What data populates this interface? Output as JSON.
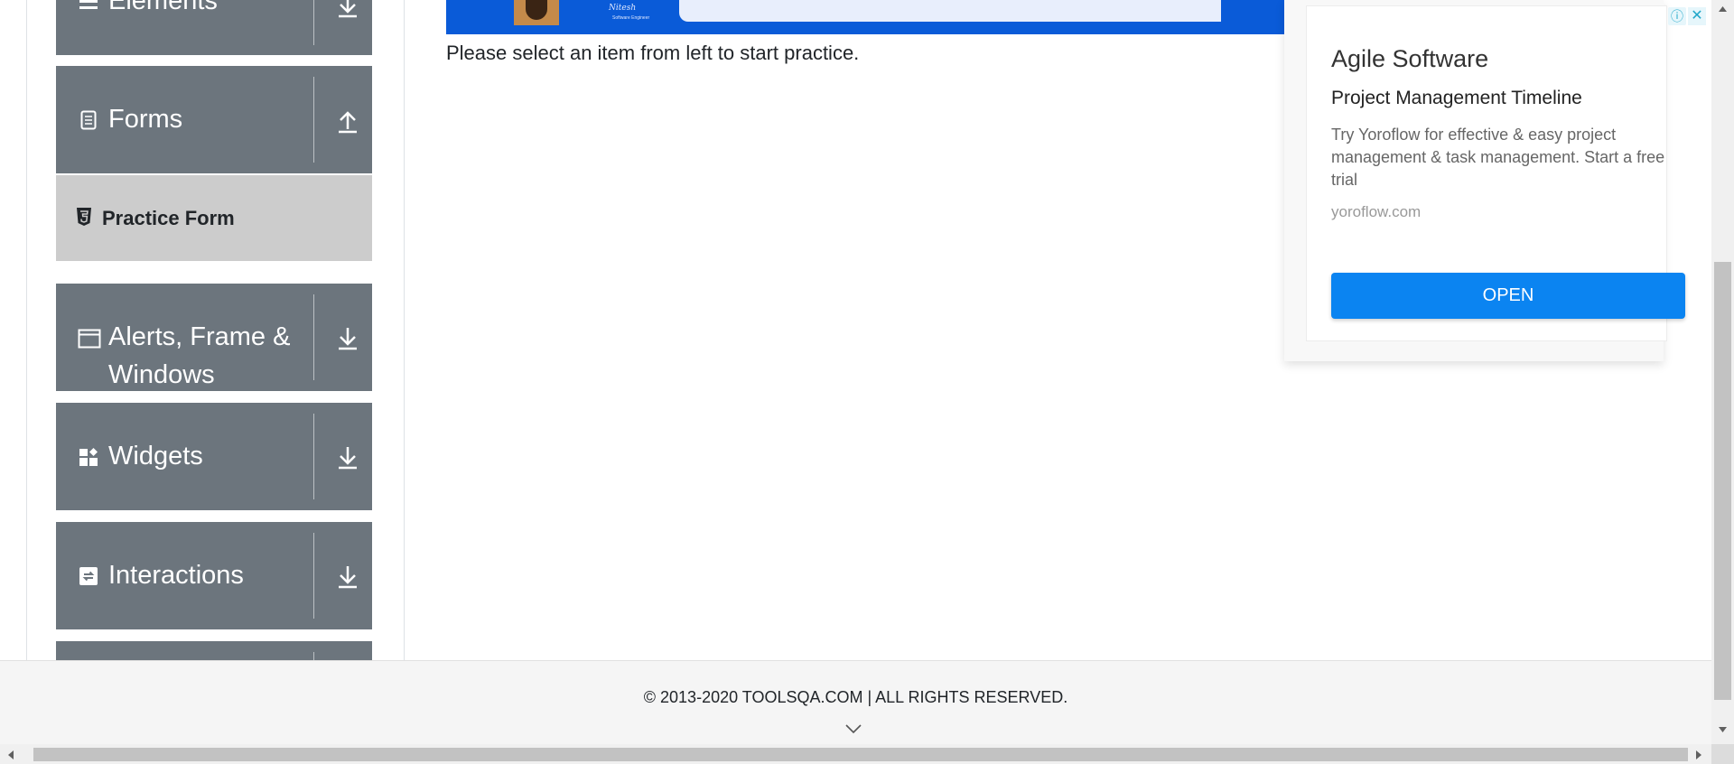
{
  "sidebar": {
    "groups": [
      {
        "label": "Elements",
        "icon": "list-icon",
        "arrow": "download-arrow-icon"
      },
      {
        "label": "Forms",
        "icon": "document-icon",
        "arrow": "upload-arrow-icon",
        "expanded": true,
        "items": [
          {
            "label": "Practice Form",
            "icon": "html5-icon"
          }
        ]
      },
      {
        "label": "Alerts, Frame & Windows",
        "line1": "Alerts, Frame &",
        "line2": "Windows",
        "icon": "window-icon",
        "arrow": "download-arrow-icon"
      },
      {
        "label": "Widgets",
        "icon": "widgets-icon",
        "arrow": "download-arrow-icon"
      },
      {
        "label": "Interactions",
        "icon": "interactions-icon",
        "arrow": "download-arrow-icon"
      }
    ]
  },
  "banner": {
    "signature": "Nitesh",
    "role": "Software Engineer"
  },
  "main": {
    "prompt": "Please select an item from left to start practice."
  },
  "ad": {
    "headline": "Agile Software",
    "subheadline": "Project Management Timeline",
    "body": "Try Yoroflow for effective & easy project management & task management. Start a free trial",
    "domain": "yoroflow.com",
    "cta": "OPEN",
    "info_glyph": "ⓘ",
    "close_glyph": "✕"
  },
  "footer": {
    "copyright": "© 2013-2020 TOOLSQA.COM | ALL RIGHTS RESERVED."
  },
  "colors": {
    "sidebar_group": "#6c757d",
    "sub_item": "#cccccc",
    "cta": "#0b84f1",
    "banner": "#0a5bd8"
  }
}
